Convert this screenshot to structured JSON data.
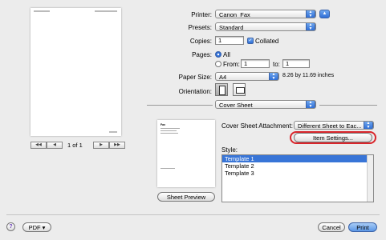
{
  "printer": {
    "label": "Printer:",
    "value": "Canon_Fax"
  },
  "presets": {
    "label": "Presets:",
    "value": "Standard"
  },
  "copies": {
    "label": "Copies:",
    "value": "1",
    "collated_label": "Collated"
  },
  "pages": {
    "label": "Pages:",
    "all_label": "All",
    "from_label": "From:",
    "from_value": "1",
    "to_label": "to:",
    "to_value": "1"
  },
  "paper_size": {
    "label": "Paper Size:",
    "value": "A4",
    "dimensions": "8.26 by 11.69 inches"
  },
  "orientation": {
    "label": "Orientation:"
  },
  "section": {
    "value": "Cover Sheet"
  },
  "cover_sheet": {
    "attachment_label": "Cover Sheet Attachment:",
    "attachment_value": "Different Sheet to Eac...",
    "item_settings_label": "Item Settings...",
    "style_label": "Style:",
    "templates": [
      "Template 1",
      "Template 2",
      "Template 3"
    ]
  },
  "sheet_preview_label": "Sheet Preview",
  "preview_nav": {
    "page_indicator": "1 of 1"
  },
  "bottom": {
    "help": "?",
    "pdf_label": "PDF ▾",
    "cancel_label": "Cancel",
    "print_label": "Print"
  },
  "colors": {
    "accent": "#3875d7",
    "highlight_ring": "#d9262c"
  }
}
